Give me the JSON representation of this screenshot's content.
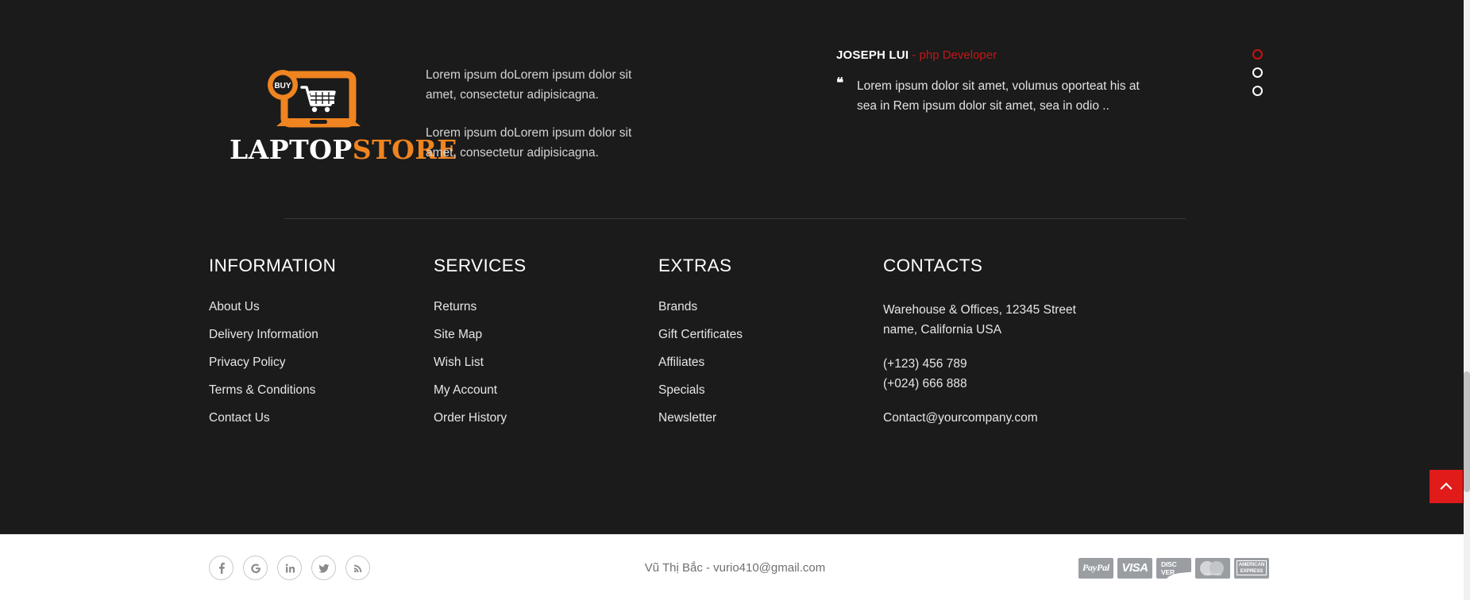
{
  "brand": {
    "logo_prefix": "LAPTOP",
    "logo_suffix": "STORE",
    "logo_badge": "BUY",
    "accent_orange": "#ef8421"
  },
  "about": {
    "paragraph_1": "Lorem ipsum doLorem ipsum dolor sit amet, consectetur adipisicagna.",
    "paragraph_2": "Lorem ipsum doLorem ipsum dolor sit amet, consectetur adipisicagna."
  },
  "testimonial": {
    "author": "JOSEPH LUI",
    "role": "- php Developer",
    "quote_mark": "“",
    "quote": "Lorem ipsum dolor sit amet, volumus oporteat his at sea in Rem ipsum dolor sit amet, sea in odio ..",
    "role_color": "#c01818",
    "active_dot_color": "#cc1111",
    "dots": [
      {
        "label": "slide-1",
        "active": true
      },
      {
        "label": "slide-2",
        "active": false
      },
      {
        "label": "slide-3",
        "active": false
      }
    ]
  },
  "columns": {
    "information": {
      "title": "INFORMATION",
      "links": [
        "About Us",
        "Delivery Information",
        "Privacy Policy",
        "Terms & Conditions",
        "Contact Us"
      ]
    },
    "services": {
      "title": "SERVICES",
      "links": [
        "Returns",
        "Site Map",
        "Wish List",
        "My Account",
        "Order History"
      ]
    },
    "extras": {
      "title": "EXTRAS",
      "links": [
        "Brands",
        "Gift Certificates",
        "Affiliates",
        "Specials",
        "Newsletter"
      ]
    },
    "contacts": {
      "title": "CONTACTS",
      "address": "Warehouse & Offices, 12345 Street name, California USA",
      "phone_1": "(+123) 456 789",
      "phone_2": "(+024) 666 888",
      "email": "Contact@yourcompany.com"
    }
  },
  "bottom": {
    "copyright": "Vũ Thị Bắc - vurio410@gmail.com",
    "socials": [
      {
        "name": "facebook-icon",
        "glyph": "f"
      },
      {
        "name": "google-icon",
        "glyph": "G"
      },
      {
        "name": "linkedin-icon",
        "glyph": "in"
      },
      {
        "name": "twitter-icon",
        "glyph": "twitter"
      },
      {
        "name": "rss-icon",
        "glyph": "rss"
      }
    ],
    "payments": [
      {
        "name": "paypal",
        "label": "PayPal"
      },
      {
        "name": "visa",
        "label": "VISA"
      },
      {
        "name": "discover",
        "label": "DISC VER"
      },
      {
        "name": "mastercard",
        "label": "mastercard"
      },
      {
        "name": "amex_line1",
        "label": "AMERICAN"
      },
      {
        "name": "amex_line2",
        "label": "EXPRESS"
      }
    ]
  },
  "scroll_top": {
    "label": "scroll-to-top",
    "color": "#e01b19"
  }
}
